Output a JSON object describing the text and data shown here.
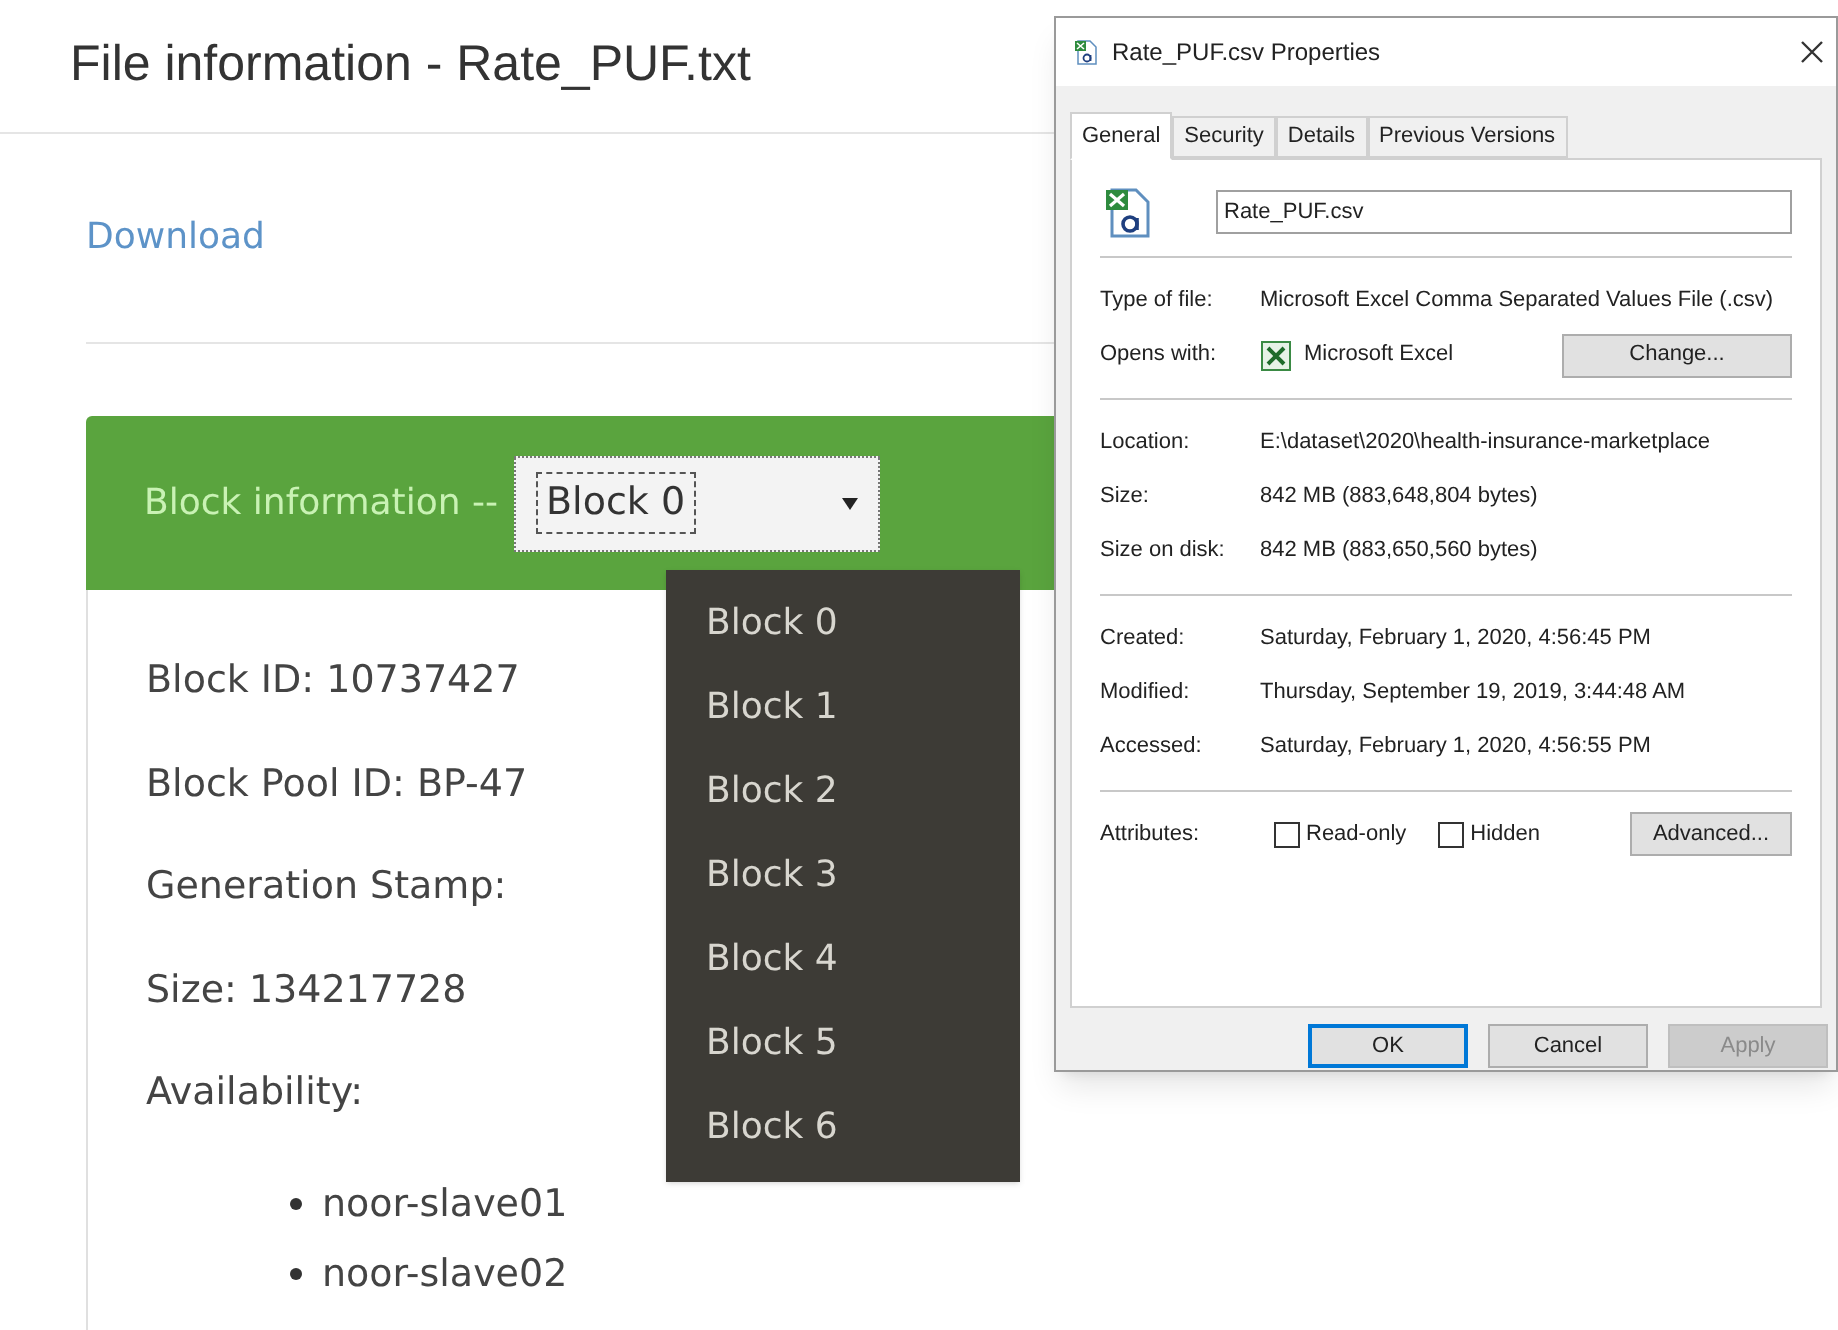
{
  "page": {
    "title": "File information - Rate_PUF.txt",
    "download_link": "Download",
    "block_panel": {
      "heading": "Block information --",
      "select": {
        "value": "Block 0",
        "expanded": true
      },
      "options": [
        {
          "label": "Block 0",
          "selected": false
        },
        {
          "label": "Block 1",
          "selected": false
        },
        {
          "label": "Block 2",
          "selected": false
        },
        {
          "label": "Block 3",
          "selected": false
        },
        {
          "label": "Block 4",
          "selected": false
        },
        {
          "label": "Block 5",
          "selected": false
        },
        {
          "label": "Block 6",
          "selected": false
        }
      ],
      "fields": [
        "Block ID: 10737427",
        "Block Pool ID: BP-47",
        "Generation Stamp:",
        "Size: 134217728"
      ],
      "availability_label": "Availability:",
      "hosts": [
        "noor-slave01",
        "noor-slave02"
      ]
    }
  },
  "dialog": {
    "title": "Rate_PUF.csv Properties",
    "tabs": [
      {
        "label": "General",
        "selected": true
      },
      {
        "label": "Security",
        "selected": false
      },
      {
        "label": "Details",
        "selected": false
      },
      {
        "label": "Previous Versions",
        "selected": false
      }
    ],
    "file_name": "Rate_PUF.csv",
    "groups": [
      [
        {
          "label": "Type of file:",
          "value": "Microsoft Excel Comma Separated Values File (.csv)"
        },
        {
          "label": "Opens with:",
          "value": "Microsoft Excel",
          "button": "Change..."
        }
      ],
      [
        {
          "label": "Location:",
          "value": "E:\\dataset\\2020\\health-insurance-marketplace"
        },
        {
          "label": "Size:",
          "value": "842 MB (883,648,804 bytes)"
        },
        {
          "label": "Size on disk:",
          "value": "842 MB (883,650,560 bytes)"
        }
      ],
      [
        {
          "label": "Created:",
          "value": "Saturday, February 1, 2020, 4:56:45 PM"
        },
        {
          "label": "Modified:",
          "value": "Thursday, September 19, 2019, 3:44:48 AM"
        },
        {
          "label": "Accessed:",
          "value": "Saturday, February 1, 2020, 4:56:55 PM"
        }
      ]
    ],
    "attributes": {
      "label": "Attributes:",
      "checkboxes": [
        {
          "label": "Read-only",
          "checked": false
        },
        {
          "label": "Hidden",
          "checked": false
        }
      ],
      "button": "Advanced..."
    },
    "buttons": [
      {
        "label": "OK",
        "default": true,
        "disabled": false
      },
      {
        "label": "Cancel",
        "default": false,
        "disabled": false
      },
      {
        "label": "Apply",
        "default": false,
        "disabled": true
      }
    ]
  }
}
